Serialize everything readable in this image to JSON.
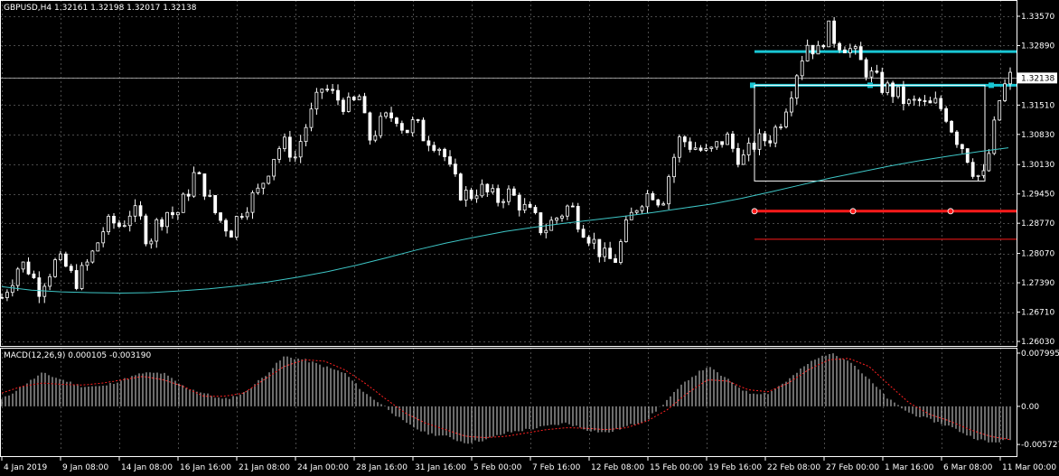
{
  "colors": {
    "background": "#000000",
    "grid": "#4a4a4a",
    "candle": "#ffffff",
    "moving_average": "#3ec6c6",
    "resistance_lines": "#19c7d4",
    "support_line": "#ff1a1a",
    "macd_signal": "#ff2020",
    "bid_line": "#c0c0c0"
  },
  "chart_data": [
    {
      "type": "candlestick",
      "header": "GBPUSD,H4  1.32161 1.32198 1.32017 1.32138",
      "symbol": "GBPUSD",
      "timeframe": "H4",
      "ohlc_current": {
        "open": 1.32161,
        "high": 1.32198,
        "low": 1.32017,
        "close": 1.32138
      },
      "current_price_label": "1.32138",
      "ylim": [
        1.2603,
        1.3357
      ],
      "grid": true,
      "y_ticks": [
        "1.33570",
        "1.32890",
        "1.32138",
        "1.31510",
        "1.30830",
        "1.30130",
        "1.29450",
        "1.28770",
        "1.28070",
        "1.27390",
        "1.26710",
        "1.26030"
      ],
      "x_ticks": [
        "4 Jan 2019",
        "9 Jan 08:00",
        "14 Jan 08:00",
        "16 Jan 16:00",
        "21 Jan 08:00",
        "24 Jan 00:00",
        "28 Jan 16:00",
        "31 Jan 16:00",
        "5 Feb 00:00",
        "7 Feb 16:00",
        "12 Feb 08:00",
        "15 Feb 00:00",
        "19 Feb 16:00",
        "22 Feb 08:00",
        "27 Feb 00:00",
        "1 Mar 16:00",
        "6 Mar 08:00",
        "11 Mar 00:00"
      ],
      "close_path": [
        1.2705,
        1.2745,
        1.2785,
        1.277,
        1.2725,
        1.276,
        1.279,
        1.2775,
        1.274,
        1.277,
        1.281,
        1.286,
        1.288,
        1.287,
        1.2905,
        1.289,
        1.2835,
        1.288,
        1.2905,
        1.2895,
        1.2935,
        1.299,
        1.2965,
        1.291,
        1.288,
        1.286,
        1.2905,
        1.293,
        1.295,
        1.3,
        1.305,
        1.306,
        1.303,
        1.3095,
        1.314,
        1.3195,
        1.3175,
        1.316,
        1.3145,
        1.317,
        1.307,
        1.31,
        1.312,
        1.313,
        1.309,
        1.311,
        1.308,
        1.307,
        1.305,
        1.299,
        1.295,
        1.294,
        1.296,
        1.2945,
        1.293,
        1.295,
        1.2935,
        1.291,
        1.289,
        1.286,
        1.288,
        1.29,
        1.292,
        1.288,
        1.285,
        1.282,
        1.279,
        1.2795,
        1.286,
        1.291,
        1.294,
        1.295,
        1.2925,
        1.301,
        1.3075,
        1.306,
        1.305,
        1.3035,
        1.3055,
        1.308,
        1.304,
        1.3025,
        1.306,
        1.307,
        1.308,
        1.312,
        1.318,
        1.325,
        1.33,
        1.327,
        1.333,
        1.33,
        1.329,
        1.327,
        1.324,
        1.3215,
        1.3195,
        1.3185,
        1.317,
        1.315,
        1.316,
        1.3145,
        1.3155,
        1.313,
        1.308,
        1.305,
        1.3,
        1.2975,
        1.307,
        1.318,
        1.3214
      ],
      "moving_average": {
        "label": "",
        "path": [
          1.273,
          1.2722,
          1.2718,
          1.2716,
          1.2715,
          1.2716,
          1.272,
          1.2725,
          1.2732,
          1.2741,
          1.2752,
          1.2765,
          1.278,
          1.2797,
          1.2815,
          1.2831,
          1.2845,
          1.2858,
          1.2868,
          1.2877,
          1.2885,
          1.2893,
          1.2902,
          1.2912,
          1.2922,
          1.2935,
          1.295,
          1.2966,
          1.2982,
          1.2996,
          1.301,
          1.3022,
          1.3033,
          1.3043,
          1.3052
        ]
      },
      "annotations": {
        "resistance_upper": 1.3275,
        "resistance_lower": 1.3197,
        "rectangle_low": 1.2975,
        "support_thick": 1.2905,
        "support_thin": 1.284
      }
    },
    {
      "type": "macd",
      "label": "MACD(12,26,9) 0.000105 -0.003190",
      "ylim": [
        -0.0068,
        0.0084
      ],
      "y_ticks": [
        "0.007995",
        "0.00",
        "-0.005727"
      ],
      "histogram_path": [
        0.001,
        0.003,
        0.005,
        0.004,
        0.003,
        0.003,
        0.004,
        0.005,
        0.005,
        0.003,
        0.002,
        0.001,
        0.002,
        0.0045,
        0.0075,
        0.007,
        0.006,
        0.005,
        0.002,
        0.0,
        -0.0025,
        -0.004,
        -0.0045,
        -0.0055,
        -0.005,
        -0.004,
        -0.0035,
        -0.003,
        -0.0025,
        -0.0035,
        -0.004,
        -0.003,
        -0.002,
        0.001,
        0.004,
        0.006,
        0.004,
        0.002,
        0.002,
        0.004,
        0.0065,
        0.008,
        0.007,
        0.004,
        0.001,
        -0.001,
        -0.002,
        -0.003,
        -0.0045,
        -0.0055,
        -0.005
      ],
      "signal_path": [
        0.002,
        0.003,
        0.0035,
        0.0033,
        0.0032,
        0.0035,
        0.004,
        0.0045,
        0.004,
        0.003,
        0.0015,
        0.0015,
        0.002,
        0.004,
        0.006,
        0.007,
        0.0068,
        0.0055,
        0.0035,
        0.0012,
        -0.001,
        -0.0025,
        -0.0035,
        -0.0045,
        -0.0047,
        -0.0045,
        -0.004,
        -0.0035,
        -0.0032,
        -0.0033,
        -0.0035,
        -0.0032,
        -0.0022,
        -0.0005,
        0.002,
        0.004,
        0.0038,
        0.0025,
        0.0022,
        0.0035,
        0.0055,
        0.007,
        0.0072,
        0.006,
        0.0032,
        0.0005,
        -0.0012,
        -0.0022,
        -0.0035,
        -0.0045,
        -0.005
      ]
    }
  ]
}
